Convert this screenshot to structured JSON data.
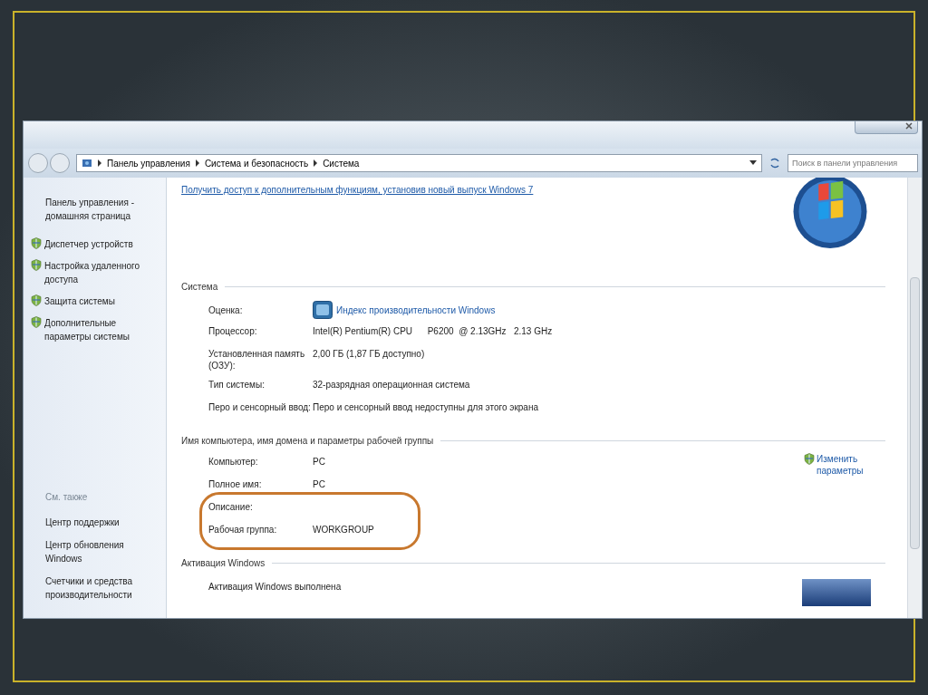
{
  "address_bar": {
    "breadcrumbs": [
      "Панель управления",
      "Система и безопасность",
      "Система"
    ]
  },
  "search": {
    "placeholder": "Поиск в панели управления"
  },
  "sidebar": {
    "home_link": "Панель управления - домашняя страница",
    "tasks": [
      "Диспетчер устройств",
      "Настройка удаленного доступа",
      "Защита системы",
      "Дополнительные параметры системы"
    ],
    "see_also_title": "См. также",
    "see_also": [
      "Центр поддержки",
      "Центр обновления Windows",
      "Счетчики и средства производительности"
    ]
  },
  "upgrade_link": "Получить доступ к дополнительным функциям, установив новый выпуск Windows 7",
  "sections": [
    {
      "title": "Система",
      "rows": [
        {
          "label": "Оценка:",
          "kind": "rating",
          "value": "Индекс производительности Windows",
          "circled": false
        },
        {
          "label": "Процессор:",
          "kind": "text",
          "value": "Intel(R) Pentium(R) CPU      P6200  @ 2.13GHz   2.13 GHz",
          "circled": false
        },
        {
          "label": "Установленная память (ОЗУ):",
          "kind": "text",
          "value": "2,00 ГБ (1,87 ГБ доступно)",
          "circled": false
        },
        {
          "label": "Тип системы:",
          "kind": "text",
          "value": "32-разрядная операционная система",
          "circled": false
        },
        {
          "label": "Перо и сенсорный ввод:",
          "kind": "text",
          "value": "Перо и сенсорный ввод недоступны для этого экрана",
          "circled": false
        }
      ]
    },
    {
      "title": "Имя компьютера, имя домена и параметры рабочей группы",
      "action": "Изменить параметры",
      "rows": [
        {
          "label": "Компьютер:",
          "kind": "text",
          "value": "PC",
          "circled": false
        },
        {
          "label": "Полное имя:",
          "kind": "text",
          "value": "PC",
          "circled": false
        },
        {
          "label": "Описание:",
          "kind": "text",
          "value": "",
          "circled": true
        },
        {
          "label": "Рабочая группа:",
          "kind": "text",
          "value": "WORKGROUP",
          "circled": true
        }
      ]
    },
    {
      "title": "Активация Windows",
      "badge": true,
      "rows": [
        {
          "label": "Активация Windows выполнена",
          "kind": "note",
          "circled": false
        }
      ]
    }
  ]
}
